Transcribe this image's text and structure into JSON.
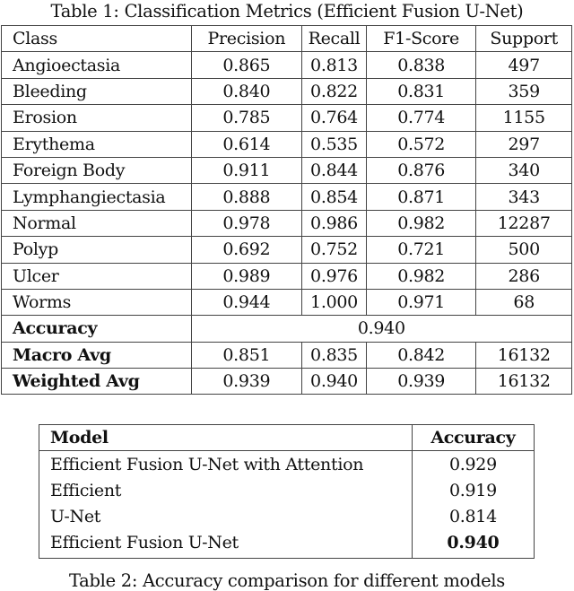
{
  "table1": {
    "caption": "Table 1: Classification Metrics (Efficient Fusion U-Net)",
    "headers": [
      "Class",
      "Precision",
      "Recall",
      "F1-Score",
      "Support"
    ],
    "rows": [
      [
        "Angioectasia",
        "0.865",
        "0.813",
        "0.838",
        "497"
      ],
      [
        "Bleeding",
        "0.840",
        "0.822",
        "0.831",
        "359"
      ],
      [
        "Erosion",
        "0.785",
        "0.764",
        "0.774",
        "1155"
      ],
      [
        "Erythema",
        "0.614",
        "0.535",
        "0.572",
        "297"
      ],
      [
        "Foreign Body",
        "0.911",
        "0.844",
        "0.876",
        "340"
      ],
      [
        "Lymphangiectasia",
        "0.888",
        "0.854",
        "0.871",
        "343"
      ],
      [
        "Normal",
        "0.978",
        "0.986",
        "0.982",
        "12287"
      ],
      [
        "Polyp",
        "0.692",
        "0.752",
        "0.721",
        "500"
      ],
      [
        "Ulcer",
        "0.989",
        "0.976",
        "0.982",
        "286"
      ],
      [
        "Worms",
        "0.944",
        "1.000",
        "0.971",
        "68"
      ]
    ],
    "accuracy": {
      "label": "Accuracy",
      "value": "0.940"
    },
    "summary_rows": [
      [
        "Macro Avg",
        "0.851",
        "0.835",
        "0.842",
        "16132"
      ],
      [
        "Weighted Avg",
        "0.939",
        "0.940",
        "0.939",
        "16132"
      ]
    ]
  },
  "table2": {
    "headers": [
      "Model",
      "Accuracy"
    ],
    "rows": [
      [
        "Efficient Fusion U-Net with Attention",
        "0.929"
      ],
      [
        "Efficient",
        "0.919"
      ],
      [
        "U-Net",
        "0.814"
      ],
      [
        "Efficient Fusion U-Net",
        "0.940"
      ]
    ],
    "best_row_index": 3,
    "caption": "Table 2: Accuracy comparison for different models"
  }
}
